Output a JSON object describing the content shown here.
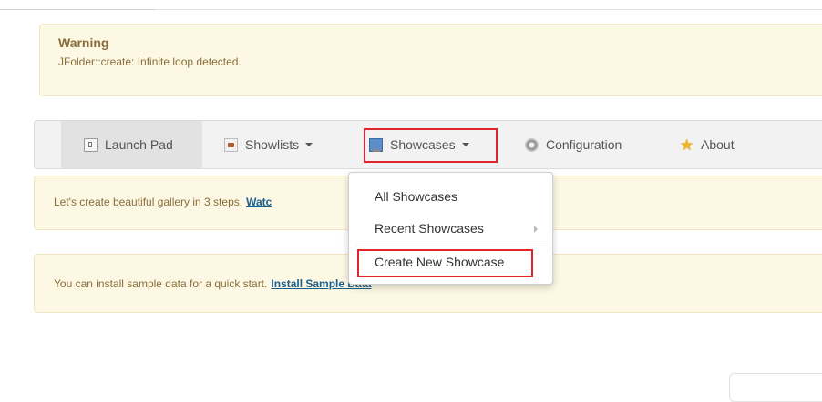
{
  "warning": {
    "title": "Warning",
    "message": "JFolder::create: Infinite loop detected."
  },
  "nav": {
    "items": [
      {
        "label": "Launch Pad",
        "icon": "launch-pad-icon"
      },
      {
        "label": "Showlists",
        "icon": "showlists-icon"
      },
      {
        "label": "Showcases",
        "icon": "monitor-icon"
      },
      {
        "label": "Configuration",
        "icon": "gear-icon"
      },
      {
        "label": "About",
        "icon": "star-icon"
      }
    ]
  },
  "notices": {
    "gallery_text": "Let's create beautiful gallery in 3 steps.",
    "gallery_link": "Watc",
    "sample_text": "You can install sample data for a quick start.",
    "sample_link": "Install Sample Data"
  },
  "dropdown": {
    "items": [
      {
        "label": "All Showcases"
      },
      {
        "label": "Recent Showcases"
      },
      {
        "label": "Create New Showcase"
      }
    ]
  },
  "colors": {
    "highlight": "#e0242b",
    "notice_bg": "#fcf8e3",
    "link": "#1a5e8c"
  }
}
